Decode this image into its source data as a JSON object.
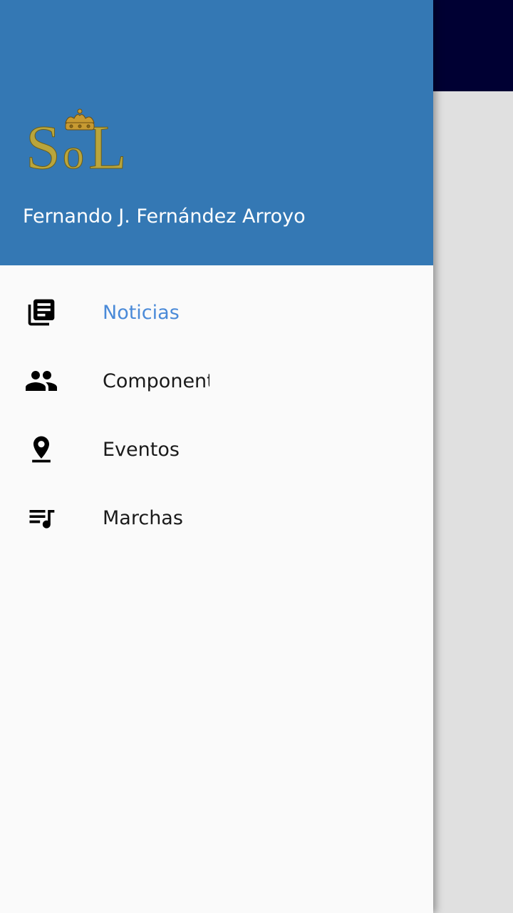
{
  "header": {
    "logo_text": "SoL",
    "user_name": "Fernando J. Fernández Arroyo"
  },
  "menu": {
    "items": [
      {
        "label": "Noticias",
        "icon": "newspaper-icon",
        "active": true
      },
      {
        "label": "Componentes",
        "icon": "people-icon",
        "active": false
      },
      {
        "label": "Eventos",
        "icon": "location-pin-icon",
        "active": false
      },
      {
        "label": "Marchas",
        "icon": "playlist-music-icon",
        "active": false
      }
    ]
  },
  "colors": {
    "header_bg": "#3478b4",
    "app_bar_bg": "#000033",
    "active_item": "#4a8ad8",
    "logo_gold": "#b9a53c"
  }
}
